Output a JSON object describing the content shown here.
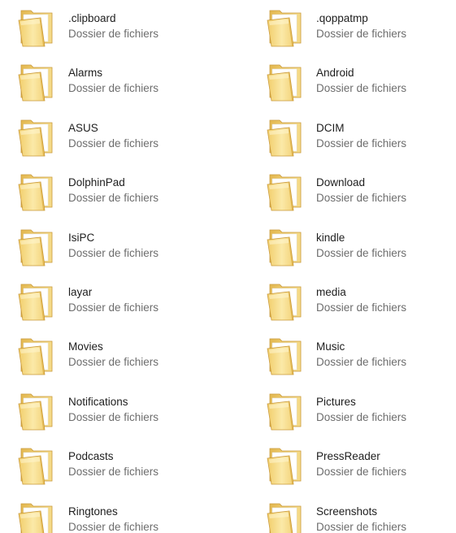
{
  "folder_type": "Dossier de fichiers",
  "items": [
    {
      "name": ".clipboard",
      "type": "Dossier de fichiers",
      "icon": "folder-icon"
    },
    {
      "name": ".qoppatmp",
      "type": "Dossier de fichiers",
      "icon": "folder-icon"
    },
    {
      "name": "Alarms",
      "type": "Dossier de fichiers",
      "icon": "folder-icon"
    },
    {
      "name": "Android",
      "type": "Dossier de fichiers",
      "icon": "folder-icon"
    },
    {
      "name": "ASUS",
      "type": "Dossier de fichiers",
      "icon": "folder-icon"
    },
    {
      "name": "DCIM",
      "type": "Dossier de fichiers",
      "icon": "folder-icon"
    },
    {
      "name": "DolphinPad",
      "type": "Dossier de fichiers",
      "icon": "folder-icon"
    },
    {
      "name": "Download",
      "type": "Dossier de fichiers",
      "icon": "folder-icon"
    },
    {
      "name": "IsiPC",
      "type": "Dossier de fichiers",
      "icon": "folder-icon"
    },
    {
      "name": "kindle",
      "type": "Dossier de fichiers",
      "icon": "folder-icon"
    },
    {
      "name": "layar",
      "type": "Dossier de fichiers",
      "icon": "folder-icon"
    },
    {
      "name": "media",
      "type": "Dossier de fichiers",
      "icon": "folder-icon"
    },
    {
      "name": "Movies",
      "type": "Dossier de fichiers",
      "icon": "folder-icon"
    },
    {
      "name": "Music",
      "type": "Dossier de fichiers",
      "icon": "folder-icon"
    },
    {
      "name": "Notifications",
      "type": "Dossier de fichiers",
      "icon": "folder-icon"
    },
    {
      "name": "Pictures",
      "type": "Dossier de fichiers",
      "icon": "folder-icon"
    },
    {
      "name": "Podcasts",
      "type": "Dossier de fichiers",
      "icon": "folder-icon"
    },
    {
      "name": "PressReader",
      "type": "Dossier de fichiers",
      "icon": "folder-icon"
    },
    {
      "name": "Ringtones",
      "type": "Dossier de fichiers",
      "icon": "folder-icon"
    },
    {
      "name": "Screenshots",
      "type": "Dossier de fichiers",
      "icon": "folder-icon"
    }
  ],
  "colors": {
    "folder_light": "#fbe7a1",
    "folder_mid": "#f2cf6e",
    "folder_dark": "#d9a93b",
    "name_text": "#1e1e1e",
    "type_text": "#6d6d6d"
  }
}
